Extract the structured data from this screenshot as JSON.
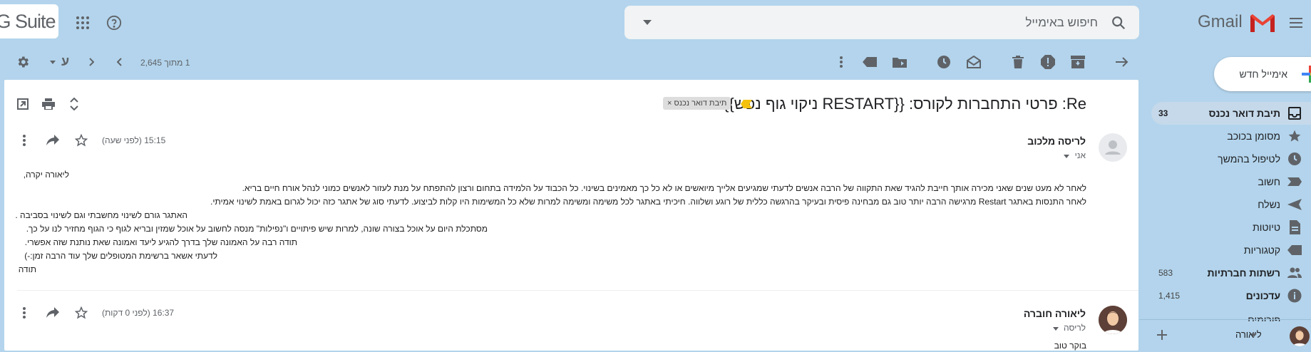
{
  "brand": {
    "gsuite_label": "G Suite",
    "gmail_label": "Gmail",
    "colors": {
      "gmail_red": "#ea4335",
      "gmail_blue": "#4285f4",
      "gmail_yellow": "#fbbc04",
      "gmail_green": "#34a853",
      "background": "#b3d4ec"
    }
  },
  "search": {
    "placeholder": "חיפוש באימייל"
  },
  "compose": {
    "label": "אימייל חדש"
  },
  "sidebar": {
    "items": [
      {
        "label": "תיבת דואר נכנס",
        "count": "33",
        "icon": "inbox-icon",
        "active": true,
        "bold": true
      },
      {
        "label": "מסומן בכוכב",
        "count": "",
        "icon": "star-icon"
      },
      {
        "label": "לטיפול בהמשך",
        "count": "",
        "icon": "clock-icon"
      },
      {
        "label": "חשוב",
        "count": "",
        "icon": "important-icon"
      },
      {
        "label": "נשלח",
        "count": "",
        "icon": "send-icon"
      },
      {
        "label": "טיוטות",
        "count": "",
        "icon": "draft-icon"
      },
      {
        "label": "קטגוריות",
        "count": "",
        "icon": "label-icon"
      },
      {
        "label": "רשתות חברתיות",
        "count": "583",
        "icon": "people-icon",
        "bold": true
      },
      {
        "label": "עדכונים",
        "count": "1,415",
        "icon": "info-icon",
        "bold": true
      },
      {
        "label": "פורומים",
        "count": "",
        "icon": "forum-icon"
      }
    ],
    "hangouts_user": "ליאורה"
  },
  "toolbar": {
    "pagination": "1 מתוך 2,645",
    "input_tool": "ע"
  },
  "thread": {
    "subject": "Re: פרטי התחברות לקורס: {{RESTART ניקוי גוף נפש}}",
    "label_chip": "תיבת דואר נכנס",
    "label_close": "×",
    "messages": [
      {
        "sender": "לריסה מלכוב",
        "to": "אני",
        "time": "15:15 (לפני שעה)",
        "body": [
          "ליאורה יקרה,",
          "לאחר לא מעט שנים שאני מכירה אותך חייבת להגיד שאת התקווה של הרבה אנשים לדעתי שמגיעים אלייך מיואשים או לא כל כך מאמינים בשינוי. כל הכבוד על הלמידה בתחום ורצון להתפתח על מנת לעזור לאנשים כמוני לנהל אורח חיים בריא.",
          "לאחר התנסות באתגר Restart מרגישה הרבה יותר טוב גם מבחינה פיסית ובעיקר בהרגשה כללית של רוגע ושלווה. חיכיתי באתגר לכל משימה ומשימה למרות שלא כל המשימות היו קלות לביצוע. לדעתי סוג של אתגר כזה יכול לגרום באמת לשינוי אמיתי.",
          "האתגר גורם לשינוי מחשבתי וגם לשינוי בסביבה .",
          "מסתכלת היום על אוכל בצורה שונה, למרות שיש פיתויים ו\"נפילות\" מנסה לחשוב על אוכל שמזין ובריא לגוף כי הגוף מחזיר לנו על כך.",
          "תודה רבה על האמונה שלך בדרך להגיע ליעד ואמונה שאת נותנת שזה אפשרי.",
          "לדעתי אשאר ברשימת המטופלים שלך עוד הרבה זמן:-)",
          "תודה"
        ]
      },
      {
        "sender": "ליאורה חוברה",
        "to": "לריסה",
        "time": "16:37 (לפני 0 דקות)",
        "body": [
          "בוקר טוב"
        ]
      }
    ]
  }
}
